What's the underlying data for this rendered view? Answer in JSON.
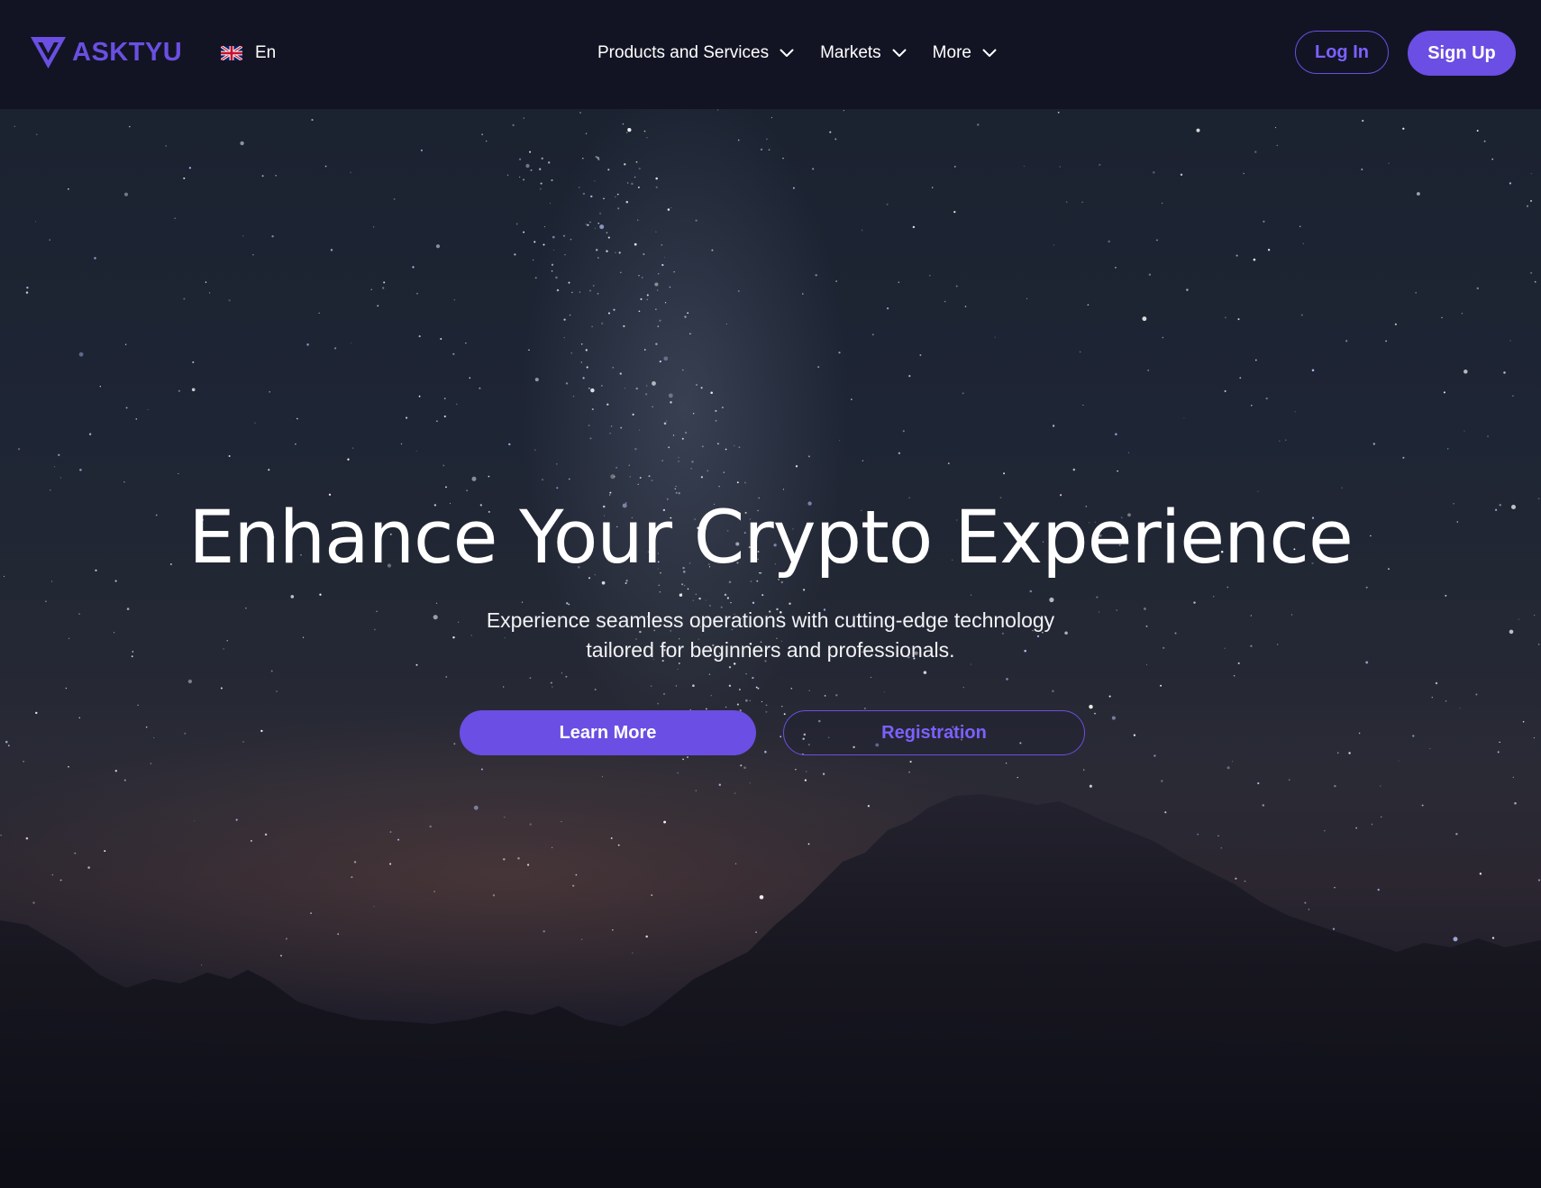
{
  "brand": {
    "name": "ASKTYU",
    "logo_icon": "v-logo-icon",
    "accent_color": "#6b4ee3"
  },
  "language": {
    "flag_icon": "uk-flag-icon",
    "label": "En"
  },
  "nav": {
    "items": [
      {
        "label": "Products and Services",
        "icon": "chevron-down-icon"
      },
      {
        "label": "Markets",
        "icon": "chevron-down-icon"
      },
      {
        "label": "More",
        "icon": "chevron-down-icon"
      }
    ]
  },
  "auth": {
    "login_label": "Log In",
    "signup_label": "Sign Up"
  },
  "hero": {
    "title": "Enhance Your Crypto Experience",
    "subtitle_line1": "Experience seamless operations with cutting-edge technology",
    "subtitle_line2": "tailored for beginners and professionals.",
    "primary_cta": "Learn More",
    "secondary_cta": "Registration",
    "background": "starry-night-sky-over-mountains"
  }
}
